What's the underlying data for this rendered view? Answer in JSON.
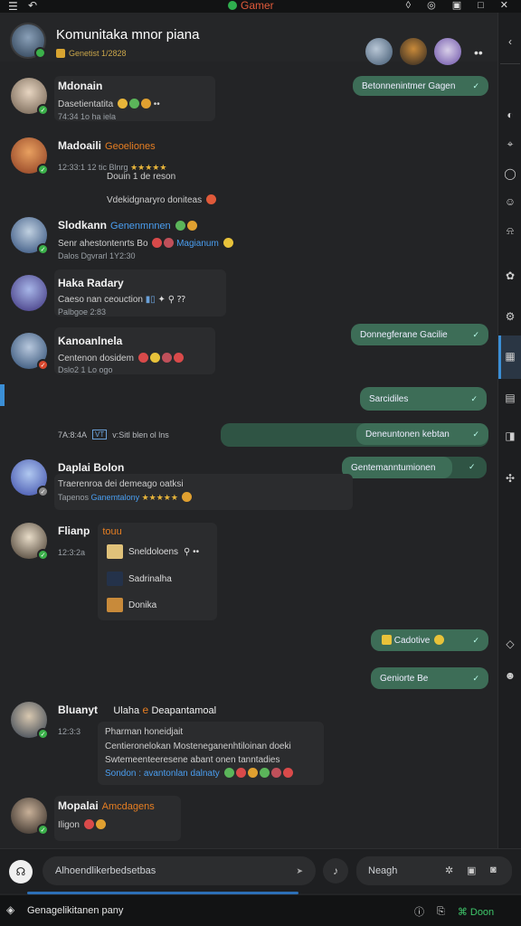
{
  "app": {
    "name": "Gamer",
    "accent": "#e05a3a"
  },
  "group": {
    "title": "Komunitaka mnor piana",
    "subtitle": "Genetist 1/2828"
  },
  "messages": [
    {
      "name": "Mdonain",
      "tag": "",
      "lines": [
        "Dasetientatita"
      ],
      "meta": "74:34  1o  ha  iela"
    },
    {
      "name": "Madoaili",
      "tag": "Geoeliones",
      "lines": [
        "Douin  1 de  reson",
        "Vdekidgnaryro doniteas"
      ],
      "meta": "12:33:1  12  tic  Blnrg"
    },
    {
      "name": "Slodkann",
      "tag": "Genenmnnen",
      "lines": [
        "Senr ahestontenrts  Bo",
        "Magianum"
      ],
      "meta": "Dalos  Dgvrarl  1Y2:30"
    },
    {
      "name": "Haka Radary",
      "tag": "",
      "lines": [
        "Caeso nan  ceouction"
      ],
      "meta": "Palbgoe  2:83"
    },
    {
      "name": "Kanoanlnela",
      "tag": "",
      "lines": [
        "Centenon dosidem"
      ],
      "meta": "Dslo2 1  Lo  ogo"
    },
    {
      "name": "Daplai Bolon",
      "tag": "",
      "lines": [
        "Traerenroa dei demeago  oatksi",
        "Ganemtalony"
      ],
      "meta": "Tapenos"
    },
    {
      "name": "Flianp",
      "tag": "touu",
      "lines": [],
      "meta": "12:3:2a"
    },
    {
      "name": "Bluanyt",
      "tag": "Deapantamoal",
      "tag_prefix": "Ulaha",
      "lines": [
        "Pharman honeidjait",
        "Centieronelokan  Mosteneganenhtiloinan doeki",
        "Swtemeenteeresene abant  onen tanntadies",
        "Sondon  :  avantonlan  dalnaty"
      ],
      "meta": "12:3:3"
    },
    {
      "name": "Mopalai",
      "tag": "Amcdagens",
      "lines": [
        "Iligon"
      ],
      "meta": ""
    }
  ],
  "outgoing": [
    {
      "text": "Betonnenintmer Gagen"
    },
    {
      "text": "Donnegferane Gacilie"
    },
    {
      "text": "Sarcidiles"
    },
    {
      "text": "Deneuntonen kebtan"
    },
    {
      "text": "Gentemanntumionen"
    },
    {
      "text": "Cadotive"
    },
    {
      "text": "Geniorte Be"
    }
  ],
  "date_separator": {
    "date": "7A:8:4A",
    "box": "VT",
    "text": "v:Sitl  blen  ol  lns"
  },
  "attachments": [
    {
      "label": "Sneldoloens"
    },
    {
      "label": "Sadrinalha"
    },
    {
      "label": "Donika"
    }
  ],
  "composer": {
    "placeholder": "Alhoendlikerbedsetbas",
    "send_label": "Neagh"
  },
  "footer": {
    "text": "Genagelikitanen pany",
    "done_label": "Doon"
  }
}
